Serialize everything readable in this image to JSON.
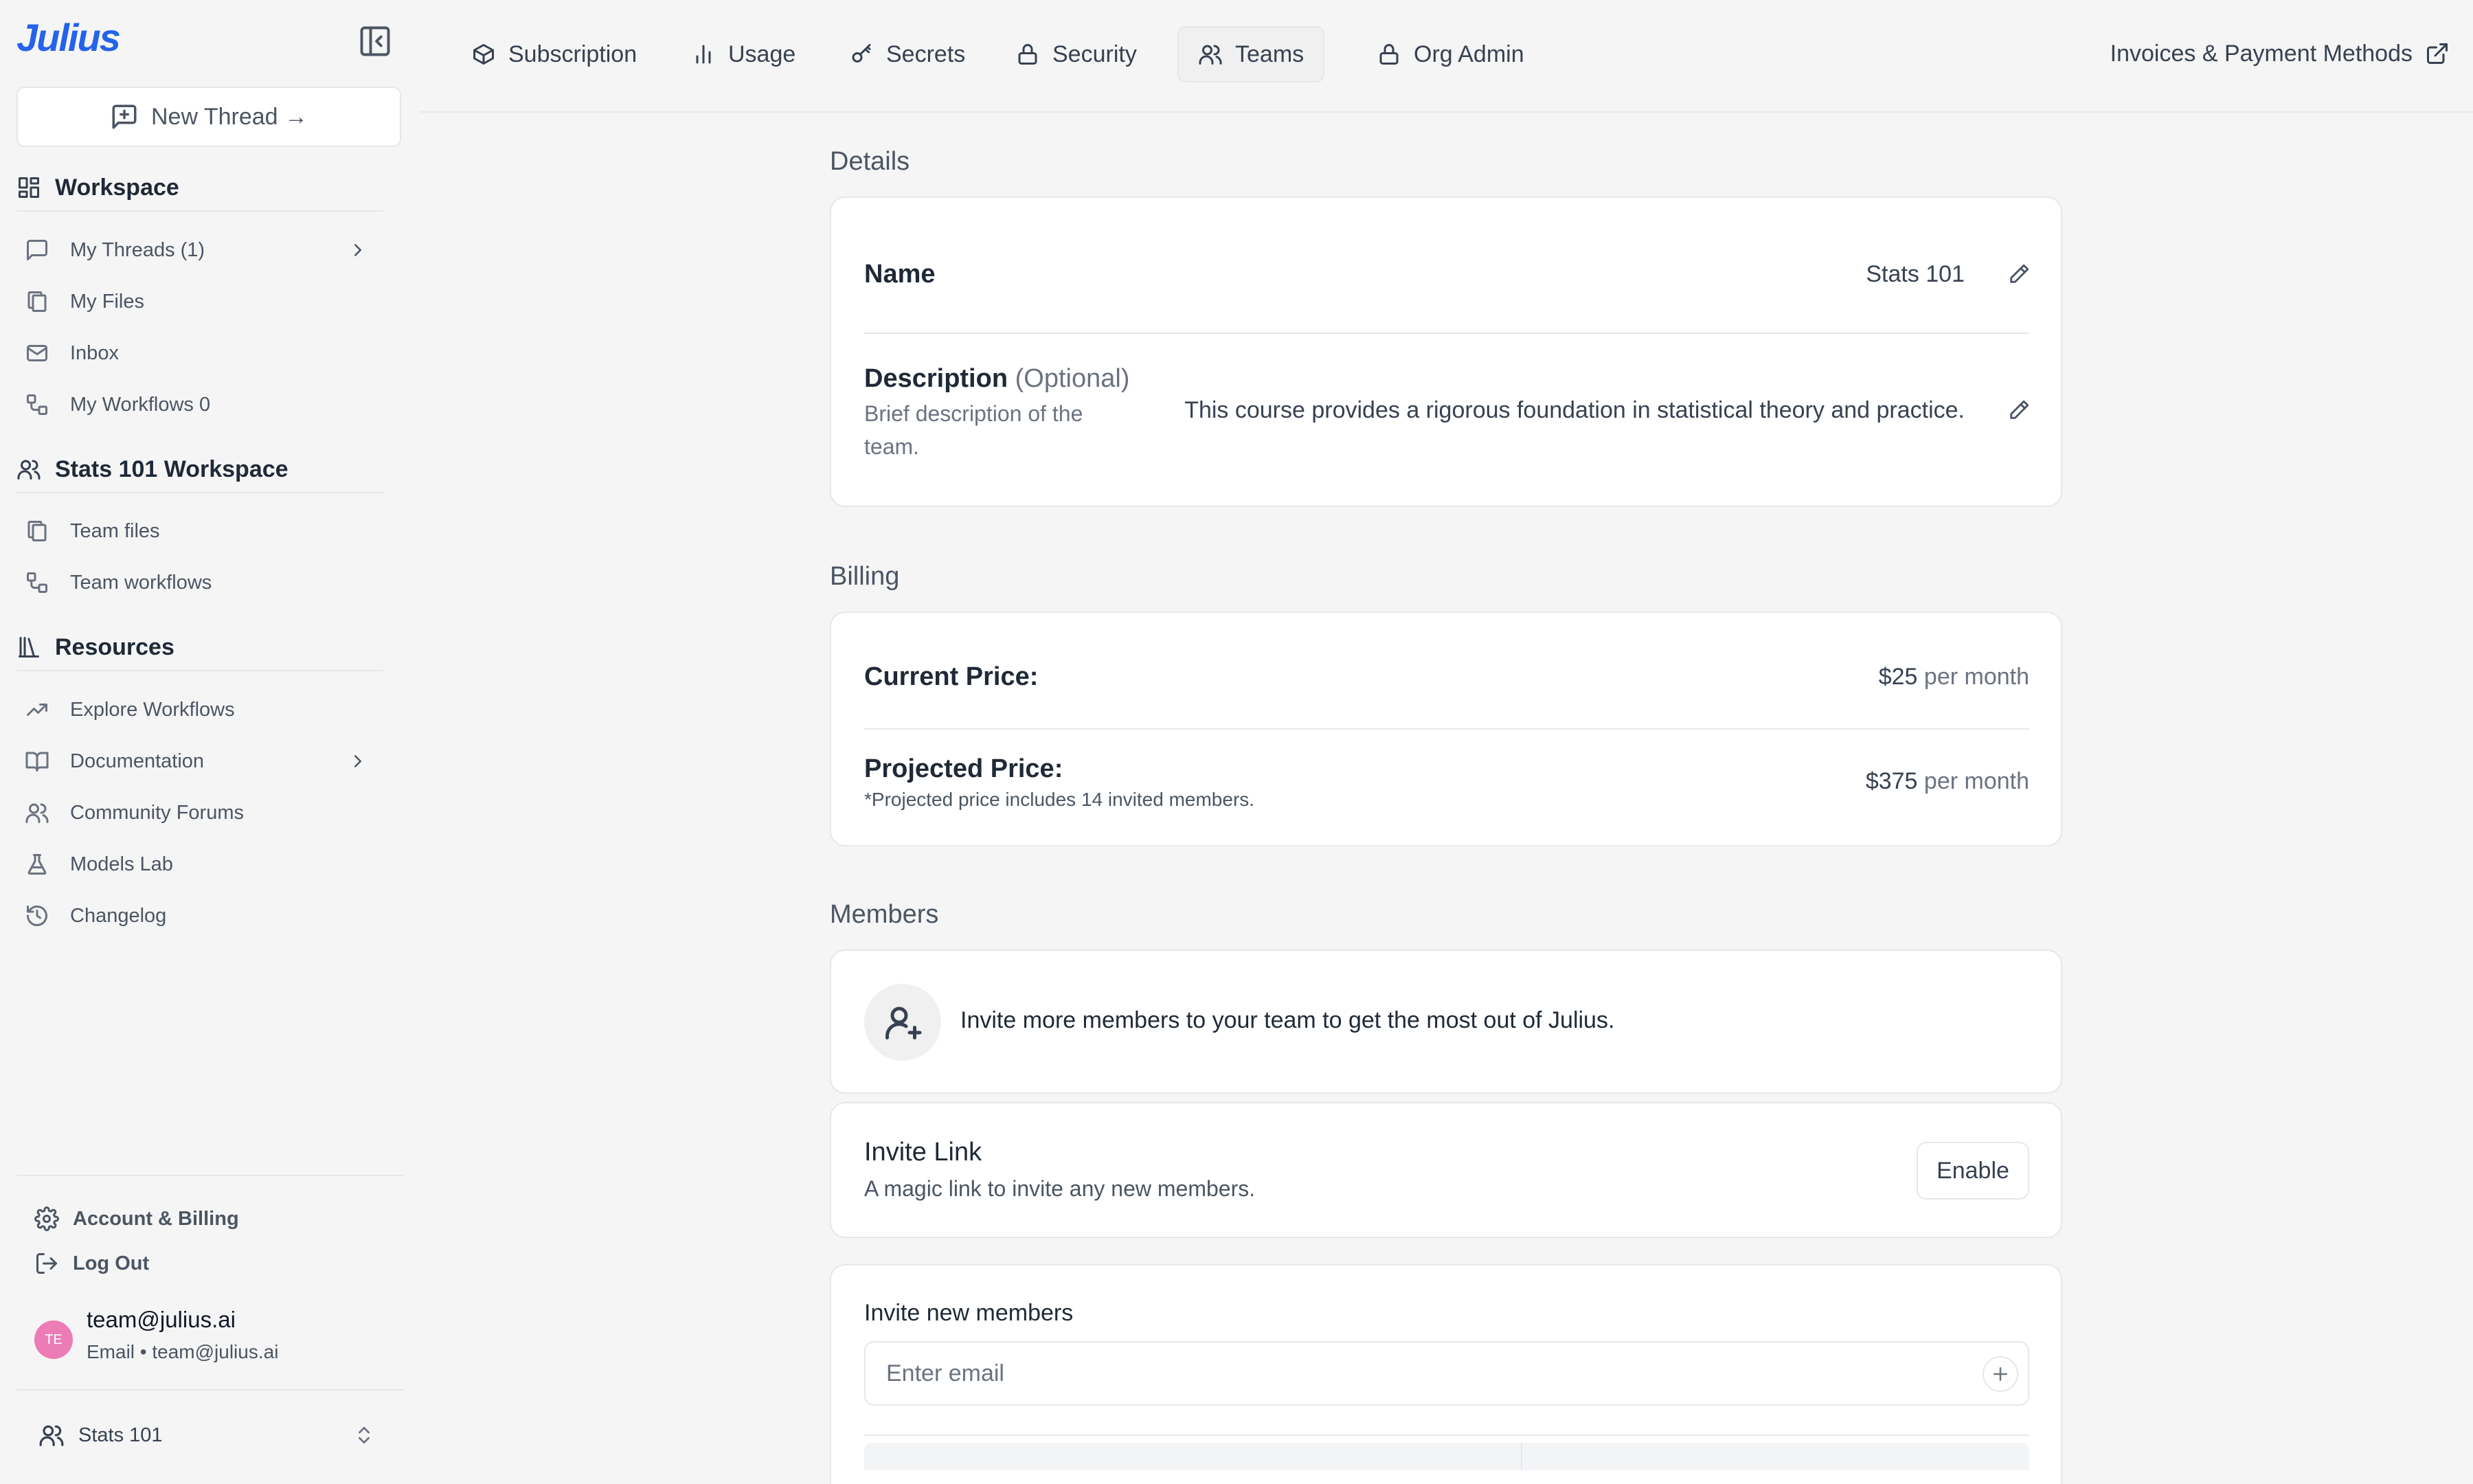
{
  "sidebar": {
    "logo": "Julius",
    "new_thread": "New Thread →",
    "workspace_title": "Workspace",
    "workspace_items": [
      {
        "label": "My Threads (1)"
      },
      {
        "label": "My Files"
      },
      {
        "label": "Inbox"
      },
      {
        "label": "My Workflows 0"
      }
    ],
    "team_title": "Stats 101 Workspace",
    "team_items": [
      {
        "label": "Team files"
      },
      {
        "label": "Team workflows"
      }
    ],
    "resources_title": "Resources",
    "resources_items": [
      {
        "label": "Explore Workflows"
      },
      {
        "label": "Documentation"
      },
      {
        "label": "Community Forums"
      },
      {
        "label": "Models Lab"
      },
      {
        "label": "Changelog"
      }
    ],
    "account_billing": "Account & Billing",
    "log_out": "Log Out",
    "user": {
      "initials": "TE",
      "email": "team@julius.ai",
      "sub": "Email • team@julius.ai",
      "avatar_color": "#ec7cb6"
    },
    "team_switcher": "Stats 101"
  },
  "topnav": {
    "tabs": [
      {
        "label": "Subscription",
        "icon": "box-icon"
      },
      {
        "label": "Usage",
        "icon": "bar-chart-icon"
      },
      {
        "label": "Secrets",
        "icon": "key-icon"
      },
      {
        "label": "Security",
        "icon": "lock-icon"
      },
      {
        "label": "Teams",
        "icon": "users-icon",
        "active": true
      },
      {
        "label": "Org Admin",
        "icon": "lock-icon"
      }
    ],
    "invoices": "Invoices & Payment Methods"
  },
  "details": {
    "title": "Details",
    "name_label": "Name",
    "name_value": "Stats 101",
    "description_label": "Description",
    "description_optional": "(Optional)",
    "description_hint": "Brief description of the team.",
    "description_value": "This course provides a rigorous foundation in statistical theory and practice."
  },
  "billing": {
    "title": "Billing",
    "current_label": "Current Price:",
    "current_value": "$25",
    "current_unit": "per month",
    "projected_label": "Projected Price:",
    "projected_note": "*Projected price includes 14 invited members.",
    "projected_value": "$375",
    "projected_unit": "per month"
  },
  "members": {
    "title": "Members",
    "invite_banner": "Invite more members to your team to get the most out of Julius.",
    "invite_link_title": "Invite Link",
    "invite_link_sub": "A magic link to invite any new members.",
    "enable_label": "Enable",
    "invite_new_title": "Invite new members",
    "email_placeholder": "Enter email"
  },
  "colors": {
    "brand": "#2563eb",
    "background": "#f5f5f5",
    "card": "#ffffff",
    "border": "#e5e7eb"
  }
}
